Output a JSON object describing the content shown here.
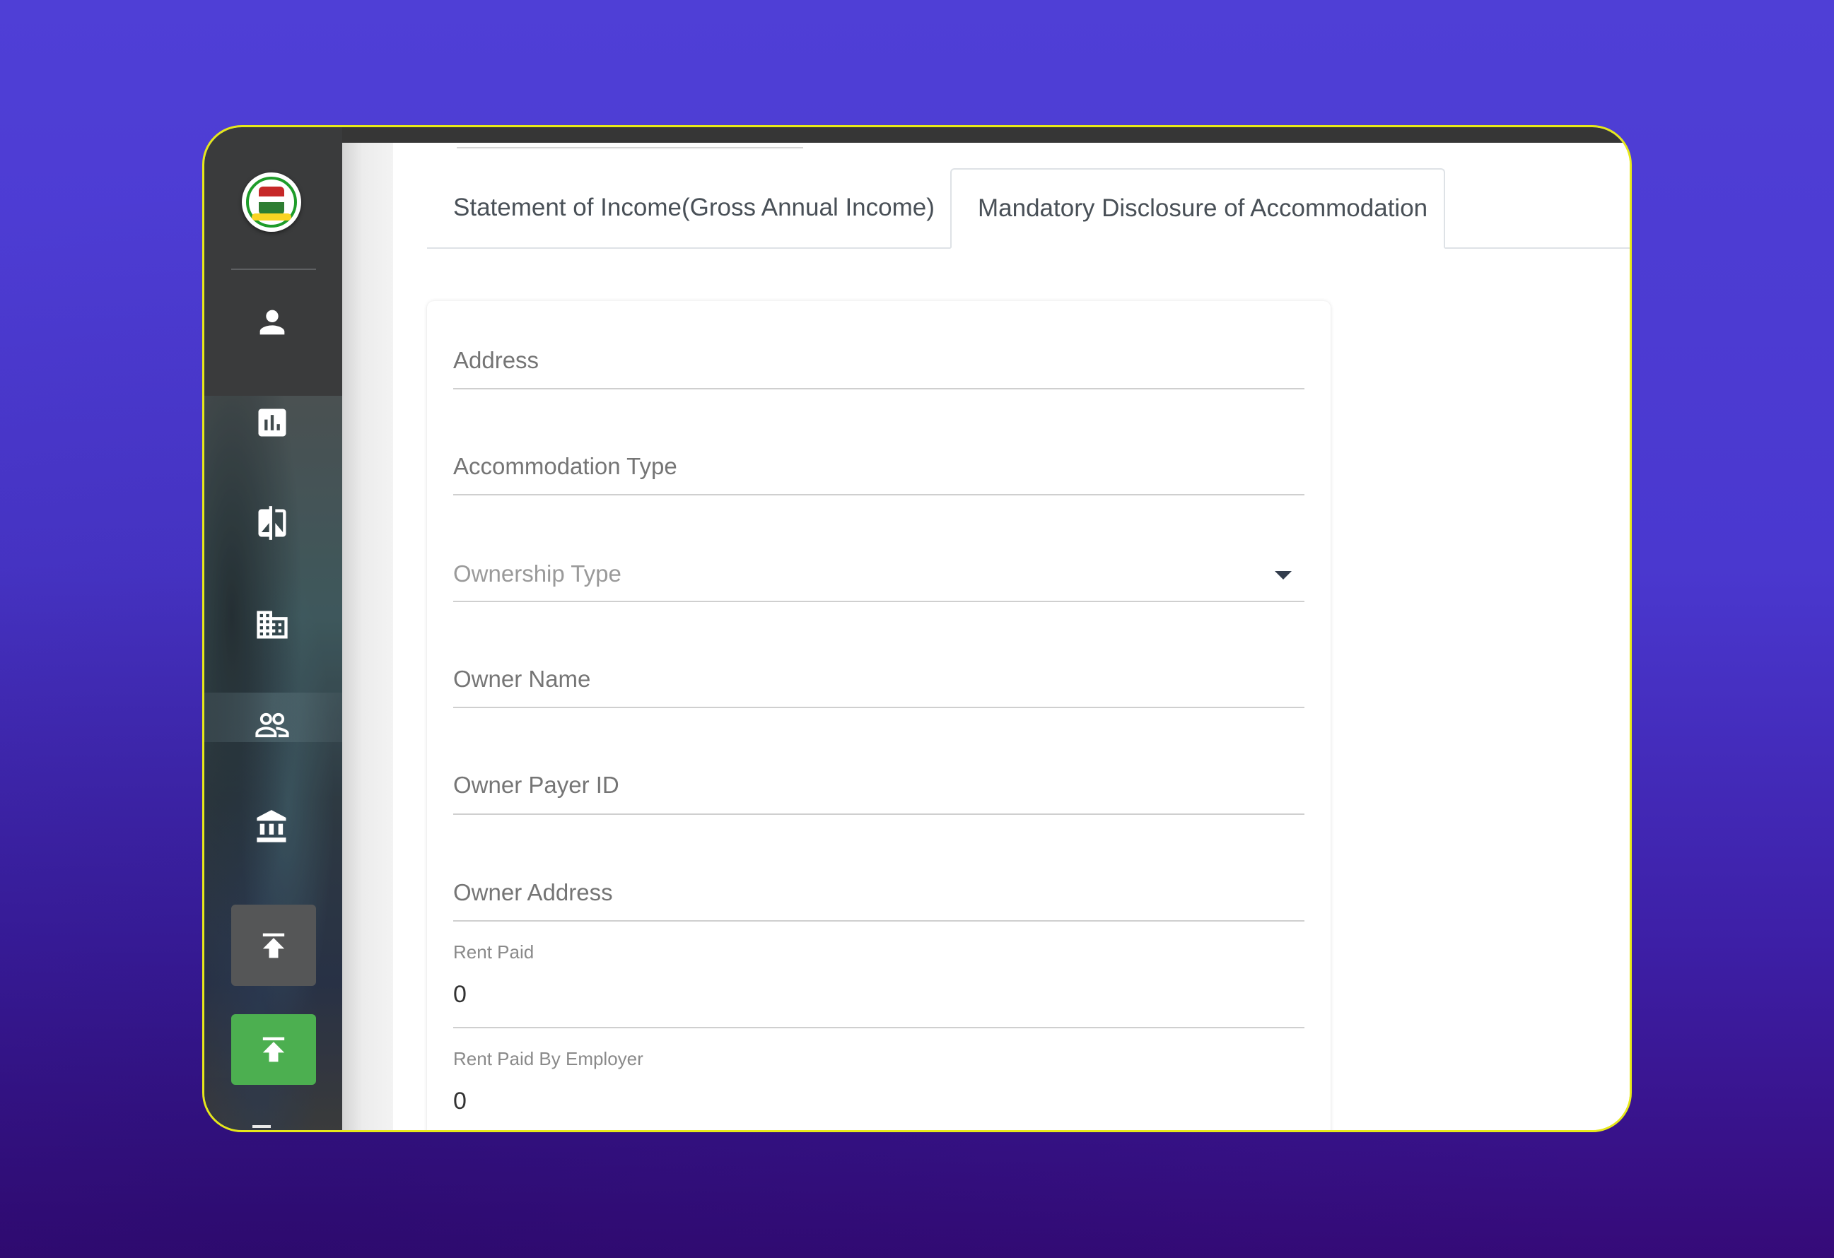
{
  "sidebar": {
    "logo": "state-revenue-seal-logo",
    "nav_items": [
      {
        "icon": "person-icon"
      },
      {
        "icon": "bar-chart-icon"
      },
      {
        "icon": "compare-icon"
      },
      {
        "icon": "building-icon"
      },
      {
        "icon": "people-icon"
      },
      {
        "icon": "bank-icon"
      },
      {
        "icon": "upload-icon"
      },
      {
        "icon": "upload-icon"
      }
    ],
    "active_color": "#4caf50"
  },
  "tabs": {
    "income": "Statement of Income(Gross Annual Income)",
    "accommodation": "Mandatory Disclosure of Accommodation",
    "active": "accommodation"
  },
  "form": {
    "address": {
      "placeholder": "Address",
      "value": ""
    },
    "accommodation_type": {
      "placeholder": "Accommodation Type",
      "value": ""
    },
    "ownership_type": {
      "placeholder": "Ownership Type",
      "value": ""
    },
    "owner_name": {
      "placeholder": "Owner Name",
      "value": ""
    },
    "owner_payer_id": {
      "placeholder": "Owner Payer ID",
      "value": ""
    },
    "owner_address": {
      "placeholder": "Owner Address",
      "value": ""
    },
    "rent_paid": {
      "label": "Rent Paid",
      "value": "0"
    },
    "rent_paid_by_employer": {
      "label": "Rent Paid By Employer",
      "value": "0"
    }
  },
  "colors": {
    "background": "#4f3fd6",
    "frame_border": "#e6e81a",
    "sidebar": "#3a3b3c",
    "active_button": "#4caf50"
  }
}
